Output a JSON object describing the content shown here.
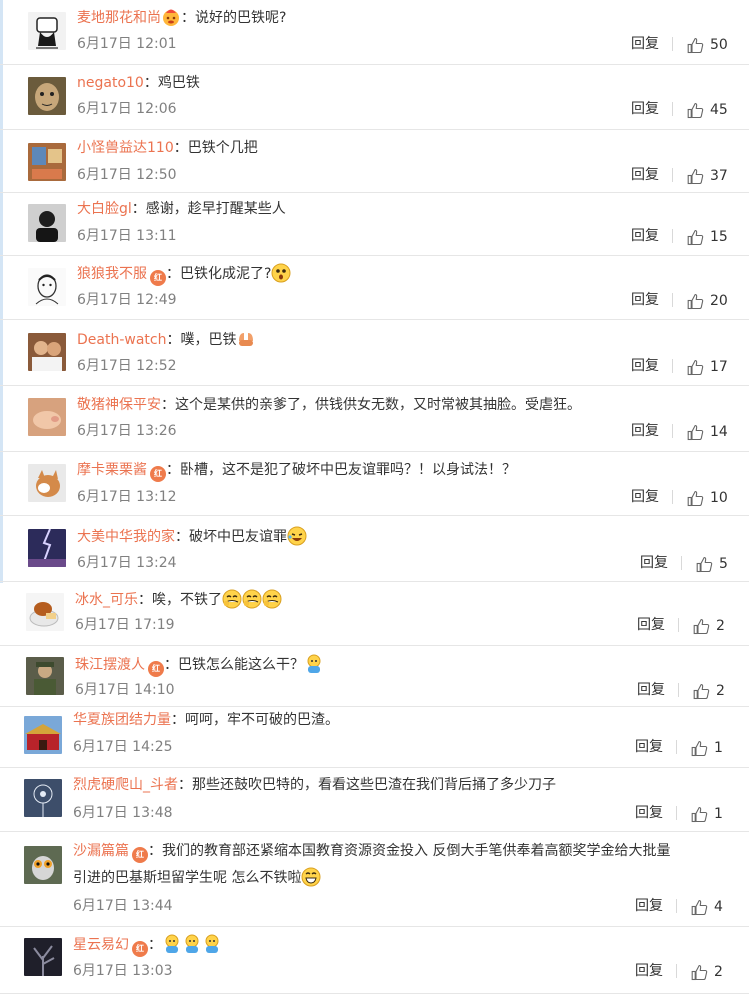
{
  "comments": [
    {
      "user": "麦地那花和尚",
      "badge": "",
      "emojis_after_name": [
        "fire-face"
      ],
      "sep": "：",
      "text": "说好的巴铁呢?",
      "emojis": [],
      "time": "6月17日 12:01",
      "reply": "回复",
      "likes": "50",
      "avatar": "mustache"
    },
    {
      "user": "negato10",
      "badge": "",
      "emojis_after_name": [],
      "sep": "：",
      "text": "鸡巴铁",
      "emojis": [],
      "time": "6月17日 12:06",
      "reply": "回复",
      "likes": "45",
      "avatar": "face-brown"
    },
    {
      "user": "小怪兽益达110",
      "badge": "",
      "emojis_after_name": [],
      "sep": "：",
      "text": "巴铁个几把",
      "emojis": [],
      "time": "6月17日 12:50",
      "reply": "回复",
      "likes": "37",
      "avatar": "room"
    },
    {
      "user": "大白脸gl",
      "badge": "",
      "emojis_after_name": [],
      "sep": "：",
      "text": "感谢，趁早打醒某些人",
      "emojis": [],
      "time": "6月17日 13:11",
      "reply": "回复",
      "likes": "15",
      "avatar": "dark-person"
    },
    {
      "user": "狼狼我不服",
      "badge": "红",
      "emojis_after_name": [],
      "sep": "：",
      "text": "巴铁化成泥了?",
      "emojis": [
        "surprised"
      ],
      "time": "6月17日 12:49",
      "reply": "回复",
      "likes": "20",
      "avatar": "sketch"
    },
    {
      "user": "Death-watch",
      "badge": "",
      "emojis_after_name": [],
      "sep": "：",
      "text": "噗，巴铁",
      "emojis": [
        "hands"
      ],
      "time": "6月17日 12:52",
      "reply": "回复",
      "likes": "17",
      "avatar": "couple"
    },
    {
      "user": "敬猪神保平安",
      "badge": "",
      "emojis_after_name": [],
      "sep": "：",
      "text": "这个是某供的亲爹了，供钱供女无数，又时常被其抽脸。受虐狂。",
      "emojis": [],
      "time": "6月17日 13:26",
      "reply": "回复",
      "likes": "14",
      "avatar": "pig"
    },
    {
      "user": "摩卡栗栗酱",
      "badge": "红",
      "emojis_after_name": [],
      "sep": "：",
      "text": "卧槽，这不是犯了破坏中巴友谊罪吗？！以身试法！？",
      "emojis": [],
      "time": "6月17日 13:12",
      "reply": "回复",
      "likes": "10",
      "avatar": "cat"
    },
    {
      "user": "大美中华我的家",
      "badge": "",
      "emojis_after_name": [],
      "sep": "：",
      "text": "破坏中巴友谊罪",
      "emojis": [
        "laugh-cry"
      ],
      "time": "6月17日 13:24",
      "reply": "回复",
      "likes": "5",
      "avatar": "lightning"
    },
    {
      "user": "冰水_可乐",
      "badge": "",
      "emojis_after_name": [],
      "sep": "：",
      "text": "唉，不铁了",
      "emojis": [
        "laugh",
        "laugh",
        "laugh"
      ],
      "time": "6月17日 17:19",
      "reply": "回复",
      "likes": "2",
      "avatar": "food"
    },
    {
      "user": "珠江摆渡人",
      "badge": "红",
      "emojis_after_name": [],
      "sep": "：",
      "text": "巴铁怎么能这么干？",
      "emojis": [
        "doll"
      ],
      "time": "6月17日 14:10",
      "reply": "回复",
      "likes": "2",
      "avatar": "soldier"
    },
    {
      "user": "华夏族团结力量",
      "badge": "",
      "emojis_after_name": [],
      "sep": "：",
      "text": "呵呵，牢不可破的巴渣。",
      "emojis": [],
      "time": "6月17日 14:25",
      "reply": "回复",
      "likes": "1",
      "avatar": "gate"
    },
    {
      "user": "烈虎硬爬山_斗者",
      "badge": "",
      "emojis_after_name": [],
      "sep": "：",
      "text": "那些还鼓吹巴特的，看看这些巴渣在我们背后捅了多少刀子",
      "emojis": [],
      "time": "6月17日 13:48",
      "reply": "回复",
      "likes": "1",
      "avatar": "dandelion"
    },
    {
      "user": "沙漏篇篇",
      "badge": "红",
      "emojis_after_name": [],
      "sep": "：",
      "text": "我们的教育部还紧缩本国教育资源资金投入 反倒大手笔供奉着高额奖学金给大批量",
      "text2": "引进的巴基斯坦留学生呢 怎么不铁啦",
      "emojis": [
        "grin"
      ],
      "time": "6月17日 13:44",
      "reply": "回复",
      "likes": "4",
      "avatar": "lemur"
    },
    {
      "user": "星云易幻",
      "badge": "红",
      "emojis_after_name": [],
      "sep": "：",
      "text": "",
      "emojis": [
        "doll",
        "doll",
        "doll"
      ],
      "time": "6月17日 13:03",
      "reply": "回复",
      "likes": "2",
      "avatar": "dark-tree"
    }
  ]
}
